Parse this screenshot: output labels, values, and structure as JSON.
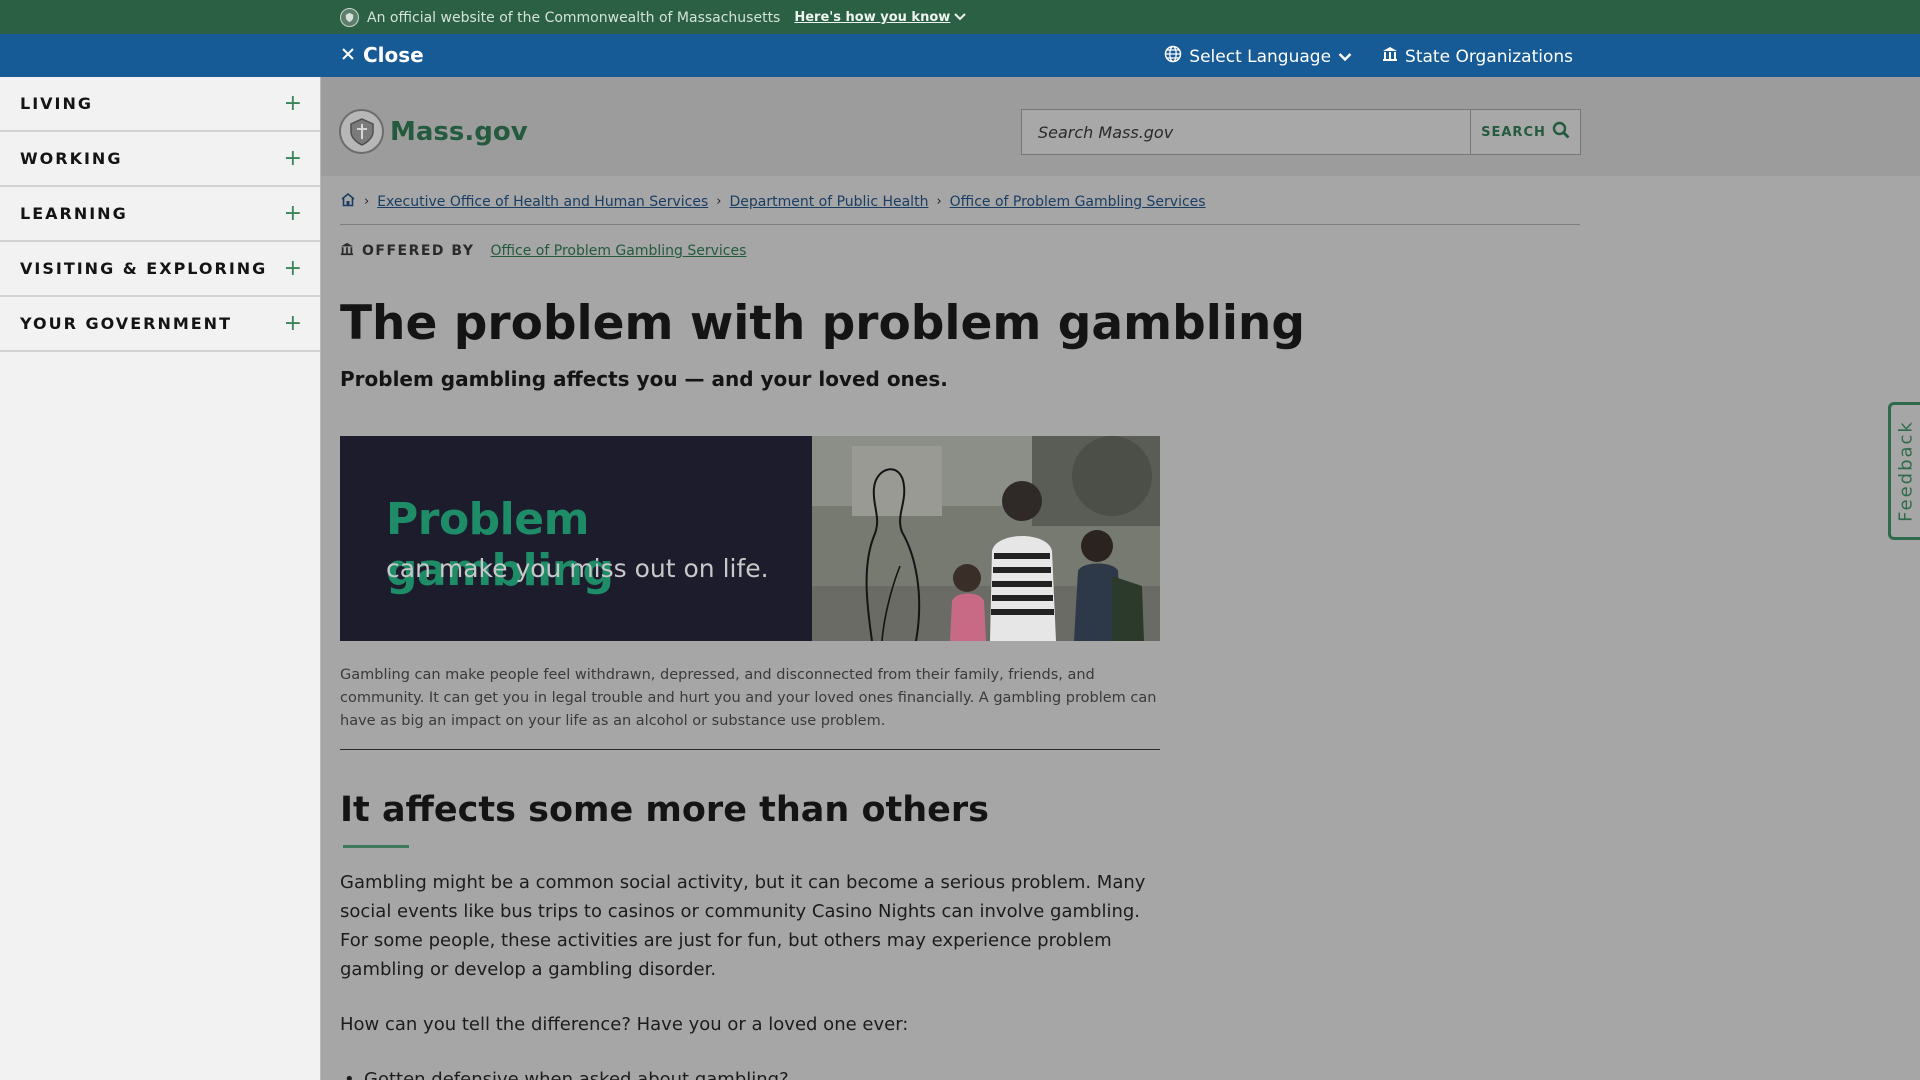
{
  "official_banner": {
    "text": "An official website of the Commonwealth of Massachusetts",
    "how_you_know": "Here's how you know"
  },
  "utility_nav": {
    "close_label": "Close",
    "language_label": "Select Language",
    "state_orgs_label": "State Organizations"
  },
  "side_nav": {
    "items": [
      {
        "label": "LIVING"
      },
      {
        "label": "WORKING"
      },
      {
        "label": "LEARNING"
      },
      {
        "label": "VISITING & EXPLORING"
      },
      {
        "label": "YOUR GOVERNMENT"
      }
    ],
    "expand_symbol": "+"
  },
  "header": {
    "logo_text": "Mass.gov",
    "search_placeholder": "Search Mass.gov",
    "search_button": "SEARCH"
  },
  "breadcrumb": {
    "items": [
      "Executive Office of Health and Human Services",
      "Department of Public Health",
      "Office of Problem Gambling Services"
    ],
    "separator": "›"
  },
  "offered_by": {
    "label": "OFFERED BY",
    "link": "Office of Problem Gambling Services"
  },
  "main": {
    "title": "The problem with problem gambling",
    "subtitle": "Problem gambling affects you — and your loved ones.",
    "hero": {
      "headline": "Problem gambling",
      "subline": "can make you miss out on life."
    },
    "caption": "Gambling can make people feel withdrawn, depressed, and disconnected from their family, friends, and community. It can get you in legal trouble and hurt you and your loved ones financially. A gambling problem can have as big an impact on your life as an alcohol or substance use problem.",
    "section_heading": "It affects some more than others",
    "paragraph_1": "Gambling might be a common social activity, but it can become a serious problem. Many social events like bus trips to casinos or community Casino Nights can involve gambling. For some people, these activities are just for fun, but others may experience problem gambling or develop a gambling disorder.",
    "paragraph_2": "How can you tell the difference? Have you or a loved one ever:",
    "bullet_1": "Gotten defensive when asked about gambling?"
  },
  "feedback": {
    "label": "Feedback"
  },
  "colors": {
    "official_green": "#2b6044",
    "utility_blue": "#165a96",
    "accent_green": "#388557",
    "hero_dark": "#1c1c2c",
    "hero_headline": "#1e8c67"
  },
  "icons": [
    "seal-icon",
    "chevron-down-icon",
    "close-icon",
    "globe-icon",
    "building-icon",
    "plus-icon",
    "search-icon",
    "home-icon",
    "chevron-right-icon"
  ]
}
